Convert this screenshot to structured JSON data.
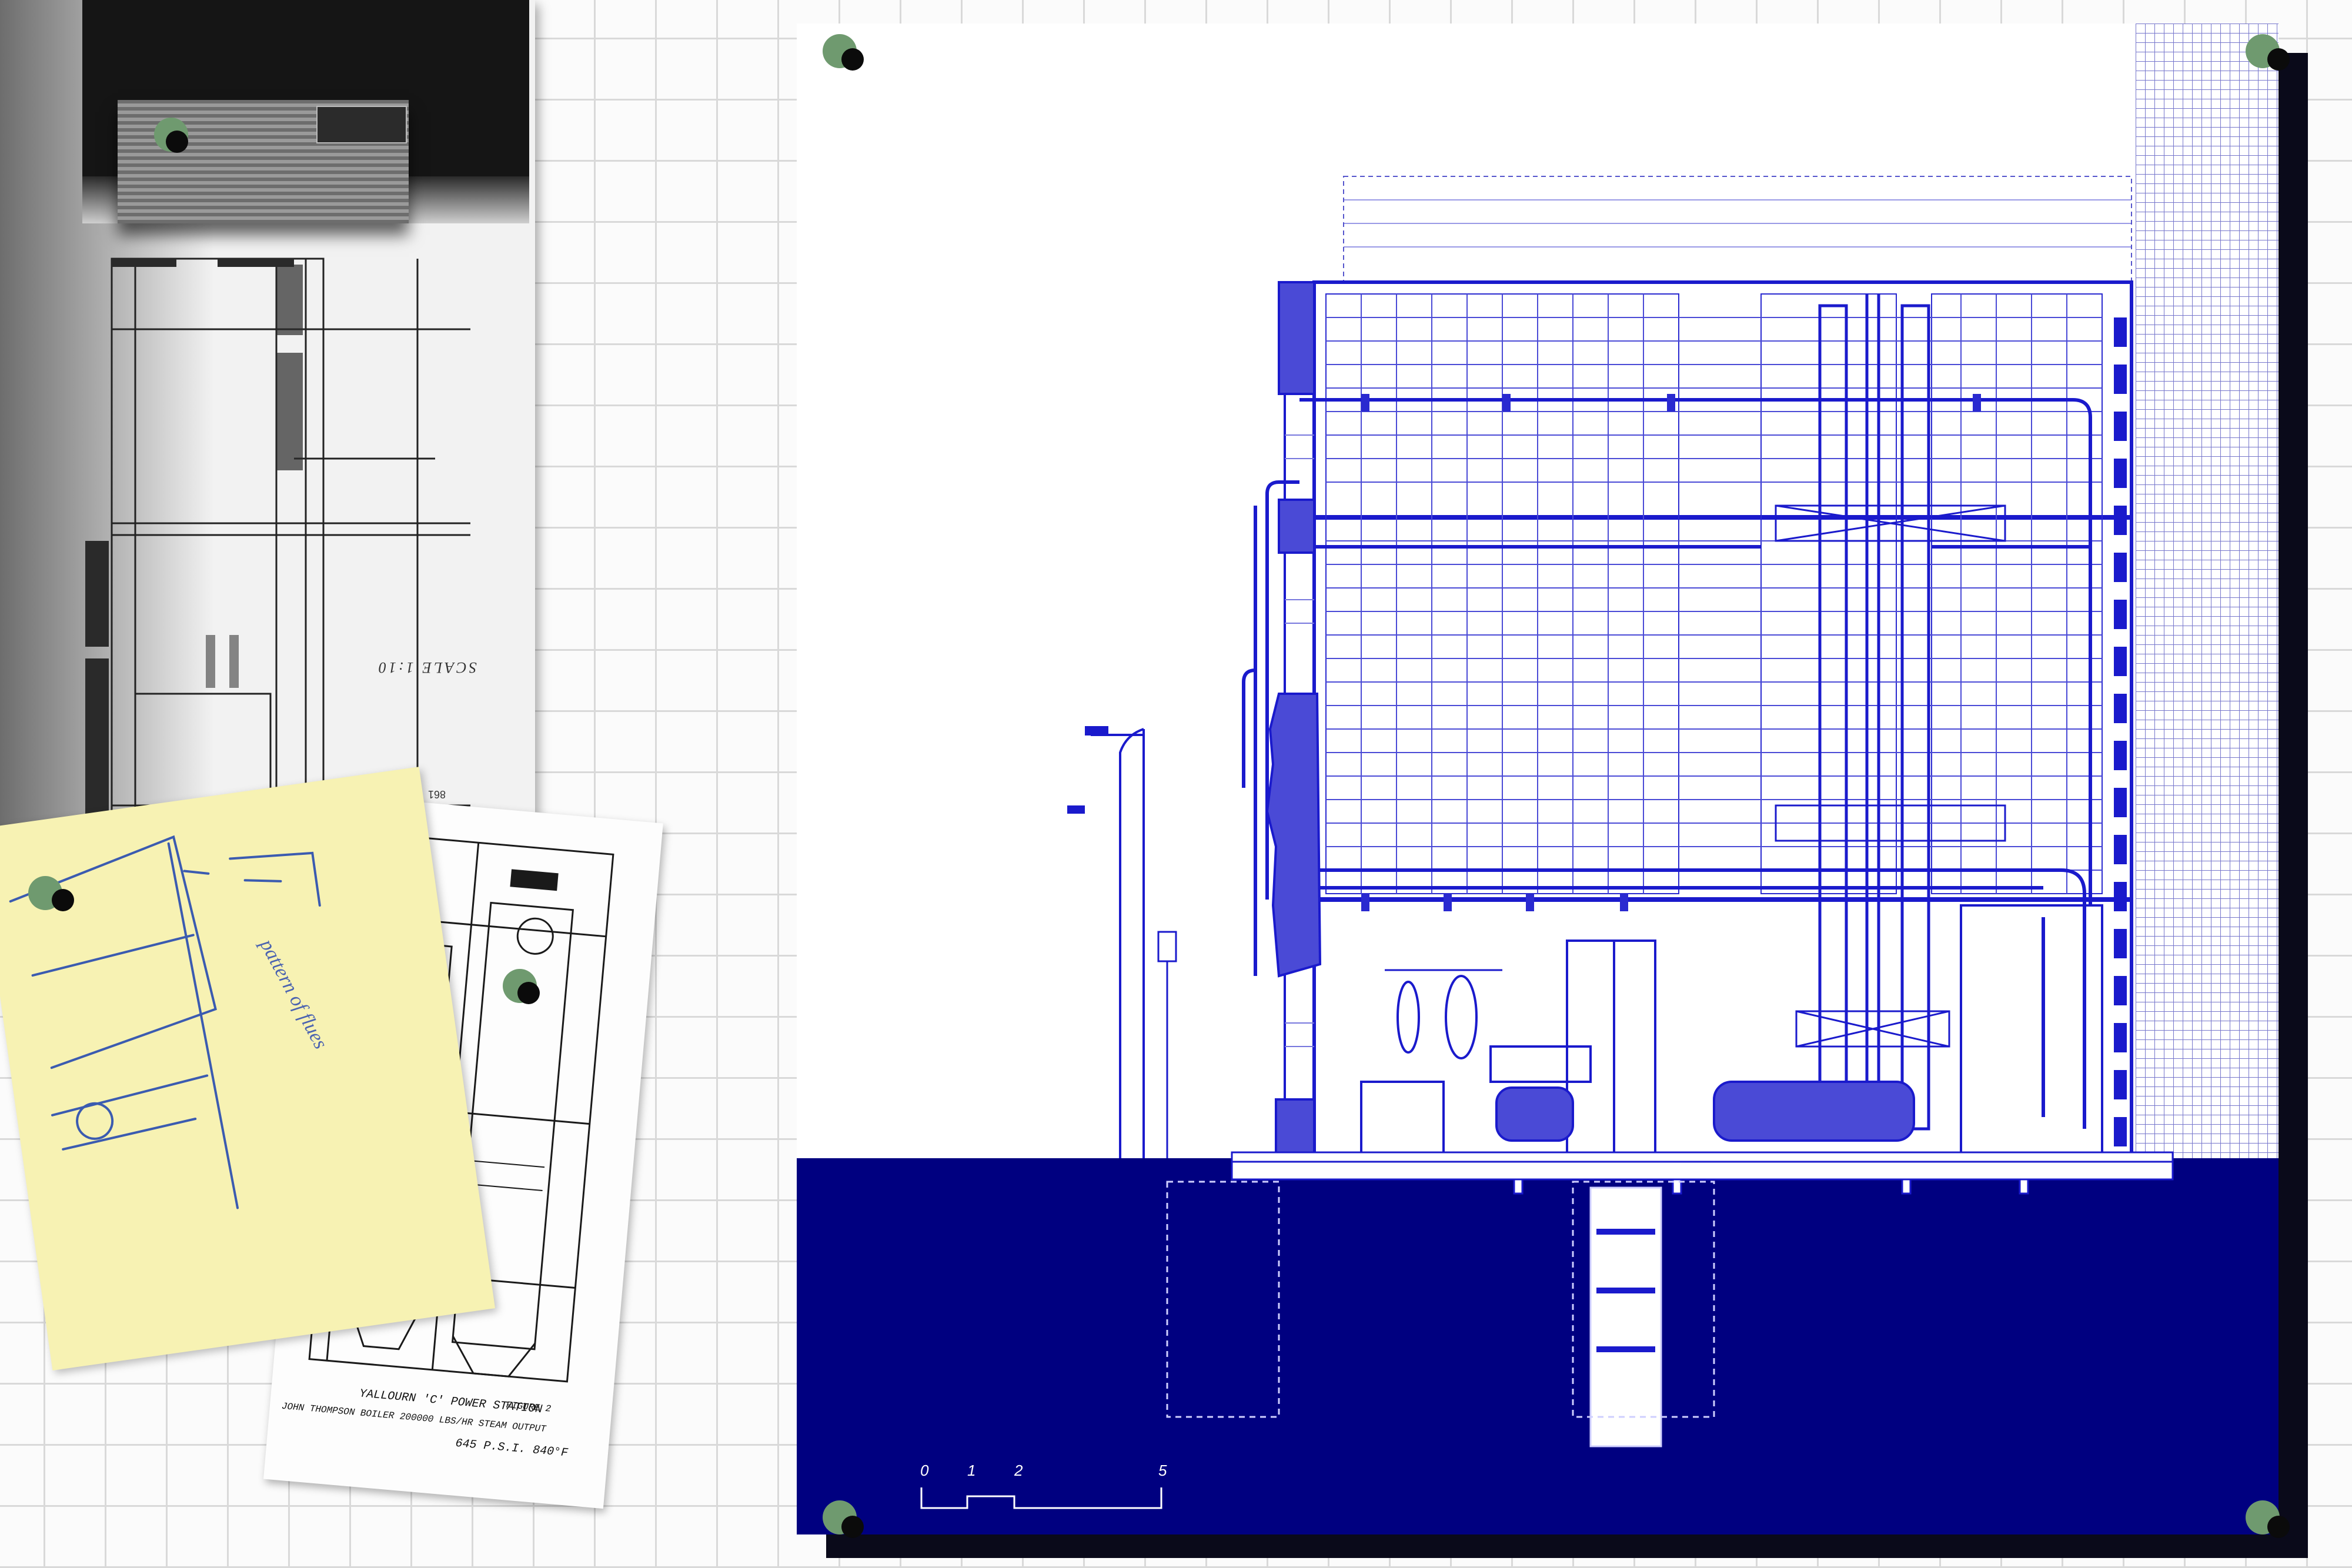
{
  "photocopy": {
    "scale_label": "SCALE 1:10",
    "page_number": "861"
  },
  "boiler_drawing": {
    "station_name": "YALLOURN 'C' POWER STATION",
    "figure_label": "FIGURE 2",
    "boiler_caption": "JOHN THOMPSON BOILER 200000 LBS/HR STEAM OUTPUT",
    "pressure_temp": "645 P.S.I.  840°F"
  },
  "trace_notes": {
    "handwriting": "pattern of flues"
  },
  "section_drawing": {
    "scale_bar": [
      "0",
      "1",
      "2",
      "5"
    ]
  },
  "colors": {
    "ink_blue": "#1a1acc",
    "ground_navy": "#000080",
    "pin_green": "#6f9a6f",
    "pin_dark": "#0b0b0b",
    "trace_yellow": "#f7f2b3"
  }
}
